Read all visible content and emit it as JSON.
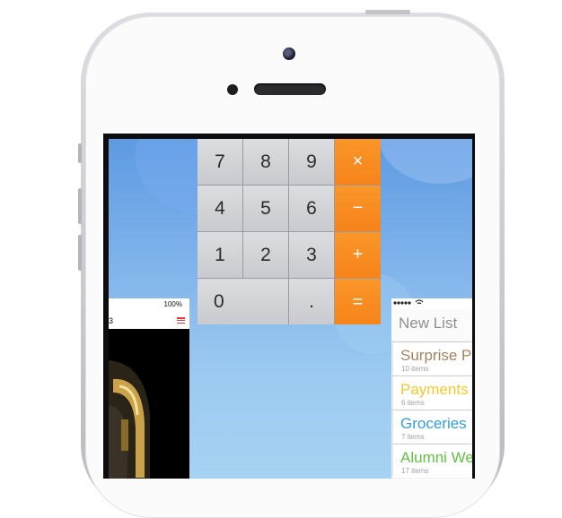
{
  "device": {
    "name": "iPhone"
  },
  "calculator": {
    "rows": [
      [
        {
          "label": "7"
        },
        {
          "label": "8"
        },
        {
          "label": "9"
        },
        {
          "label": "×",
          "op": true
        }
      ],
      [
        {
          "label": "4"
        },
        {
          "label": "5"
        },
        {
          "label": "6"
        },
        {
          "label": "−",
          "op": true
        }
      ],
      [
        {
          "label": "1"
        },
        {
          "label": "2"
        },
        {
          "label": "3"
        },
        {
          "label": "+",
          "op": true
        }
      ],
      [
        {
          "label": "0",
          "zero": true
        },
        {
          "label": "."
        },
        {
          "label": "=",
          "op": true
        }
      ]
    ],
    "colors": {
      "key": "#d4d5d8",
      "operator": "#f78c20"
    }
  },
  "music_app": {
    "battery": "100%",
    "number": "3",
    "list_icon": "list-icon"
  },
  "reminders_app": {
    "new_list": "New List",
    "lists": [
      {
        "title": "Surprise P",
        "count": "10 items",
        "color": "#a2845e"
      },
      {
        "title": "Payments",
        "count": "6 items",
        "color": "#f5c829"
      },
      {
        "title": "Groceries",
        "count": "7 items",
        "color": "#2f9fe0"
      },
      {
        "title": "Alumni We",
        "count": "17 items",
        "color": "#62c342"
      }
    ]
  }
}
